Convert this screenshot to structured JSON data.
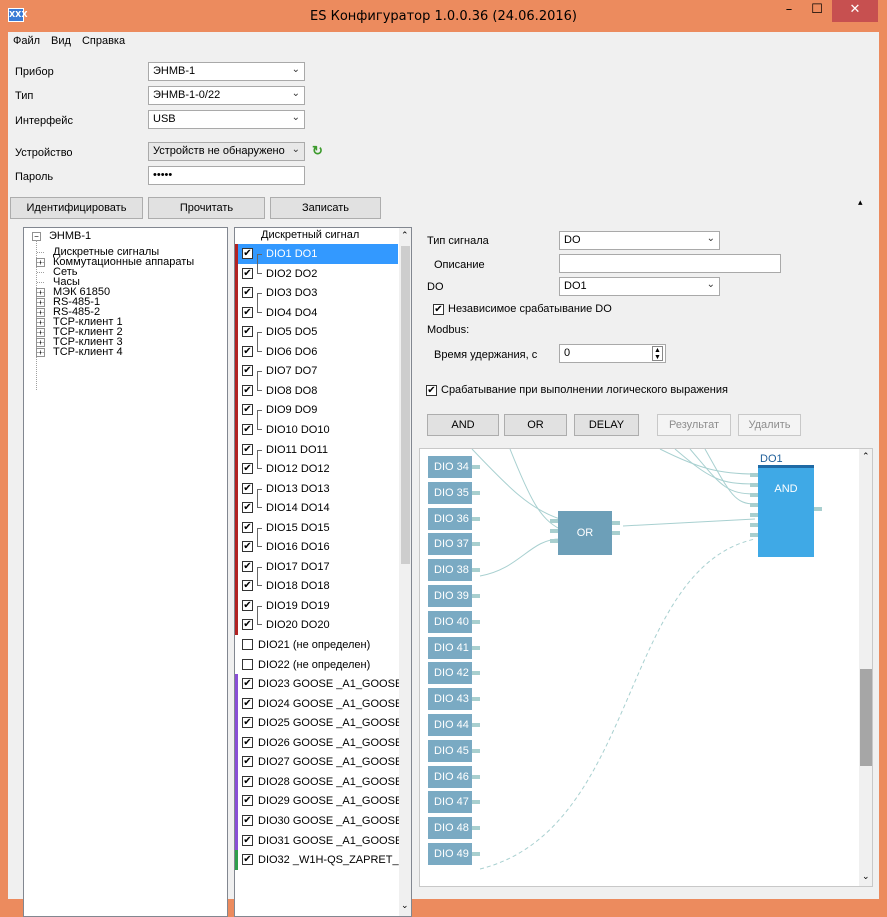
{
  "window": {
    "title": "ES Конфигуратор 1.0.0.36 (24.06.2016)",
    "logo": "XXX",
    "minimize": "–",
    "maximize": "☐",
    "close": "✕"
  },
  "menu": [
    "Файл",
    "Вид",
    "Справка"
  ],
  "form": {
    "pribor_label": "Прибор",
    "pribor_value": "ЭНМВ-1",
    "tip_label": "Тип",
    "tip_value": "ЭНМВ-1-0/22",
    "interface_label": "Интерфейс",
    "interface_value": "USB",
    "device_label": "Устройство",
    "device_value": "Устройств не обнаружено",
    "password_label": "Пароль",
    "password_value": "•••••"
  },
  "buttons": {
    "identify": "Идентифицировать",
    "read": "Прочитать",
    "write": "Записать"
  },
  "tree": {
    "root": "ЭНМВ-1",
    "items": [
      {
        "label": "Дискретные сигналы",
        "expandable": false
      },
      {
        "label": "Коммутационные аппараты",
        "expandable": true
      },
      {
        "label": "Сеть",
        "expandable": false
      },
      {
        "label": "Часы",
        "expandable": false
      },
      {
        "label": "МЭК 61850",
        "expandable": true
      },
      {
        "label": "RS-485-1",
        "expandable": true
      },
      {
        "label": "RS-485-2",
        "expandable": true
      },
      {
        "label": "TCP-клиент 1",
        "expandable": true
      },
      {
        "label": "TCP-клиент 2",
        "expandable": true
      },
      {
        "label": "TCP-клиент 3",
        "expandable": true
      },
      {
        "label": "TCP-клиент 4",
        "expandable": true
      }
    ]
  },
  "signals": {
    "header": "Дискретный сигнал",
    "rows": [
      {
        "label": "DIO1 DO1",
        "checked": true,
        "selected": true
      },
      {
        "label": "DIO2 DO2",
        "checked": true
      },
      {
        "label": "DIO3 DO3",
        "checked": true
      },
      {
        "label": "DIO4 DO4",
        "checked": true
      },
      {
        "label": "DIO5 DO5",
        "checked": true
      },
      {
        "label": "DIO6 DO6",
        "checked": true
      },
      {
        "label": "DIO7 DO7",
        "checked": true
      },
      {
        "label": "DIO8 DO8",
        "checked": true
      },
      {
        "label": "DIO9 DO9",
        "checked": true
      },
      {
        "label": "DIO10 DO10",
        "checked": true
      },
      {
        "label": "DIO11 DO11",
        "checked": true
      },
      {
        "label": "DIO12 DO12",
        "checked": true
      },
      {
        "label": "DIO13 DO13",
        "checked": true
      },
      {
        "label": "DIO14 DO14",
        "checked": true
      },
      {
        "label": "DIO15 DO15",
        "checked": true
      },
      {
        "label": "DIO16 DO16",
        "checked": true
      },
      {
        "label": "DIO17 DO17",
        "checked": true
      },
      {
        "label": "DIO18 DO18",
        "checked": true
      },
      {
        "label": "DIO19 DO19",
        "checked": true
      },
      {
        "label": "DIO20 DO20",
        "checked": true
      },
      {
        "label": "DIO21 (не определен)",
        "checked": false
      },
      {
        "label": "DIO22 (не определен)",
        "checked": false
      },
      {
        "label": "DIO23 GOOSE _A1_GOOSE",
        "checked": true
      },
      {
        "label": "DIO24 GOOSE _A1_GOOSE",
        "checked": true
      },
      {
        "label": "DIO25 GOOSE _A1_GOOSE",
        "checked": true
      },
      {
        "label": "DIO26 GOOSE _A1_GOOSE",
        "checked": true
      },
      {
        "label": "DIO27 GOOSE _A1_GOOSE",
        "checked": true
      },
      {
        "label": "DIO28 GOOSE _A1_GOOSE",
        "checked": true
      },
      {
        "label": "DIO29 GOOSE _A1_GOOSE",
        "checked": true
      },
      {
        "label": "DIO30 GOOSE _A1_GOOSE",
        "checked": true
      },
      {
        "label": "DIO31 GOOSE _A1_GOOSE",
        "checked": true
      },
      {
        "label": "DIO32 _W1H-QS_ZAPRET_...",
        "checked": true
      }
    ]
  },
  "props": {
    "signal_type_label": "Тип сигнала",
    "signal_type_value": "DO",
    "description_label": "Описание",
    "description_value": "",
    "do_label": "DO",
    "do_value": "DO1",
    "independent_label": "Независимое срабатывание DO",
    "modbus_label": "Modbus:",
    "hold_label": "Время удержания, с",
    "hold_value": "0",
    "logic_label": "Срабатывание при выполнении логического выражения"
  },
  "logic_buttons": {
    "and": "AND",
    "or": "OR",
    "delay": "DELAY",
    "result": "Результат",
    "delete": "Удалить"
  },
  "diagram": {
    "inputs": [
      "DIO 34",
      "DIO 35",
      "DIO 36",
      "DIO 37",
      "DIO 38",
      "DIO 39",
      "DIO 40",
      "DIO 41",
      "DIO 42",
      "DIO 43",
      "DIO 44",
      "DIO 45",
      "DIO 46",
      "DIO 47",
      "DIO 48",
      "DIO 49"
    ],
    "or_label": "OR",
    "and_label": "AND",
    "output_label": "DO1"
  },
  "colors": {
    "titlebar": "#ec8b5e",
    "selection": "#3399ff",
    "dio_block": "#7aaac3",
    "or_block": "#6d9fb8",
    "and_block": "#3fa9e6",
    "do_group": "#b22222",
    "goose_group": "#8a4fd6",
    "w1h_group": "#2e9e4a"
  }
}
